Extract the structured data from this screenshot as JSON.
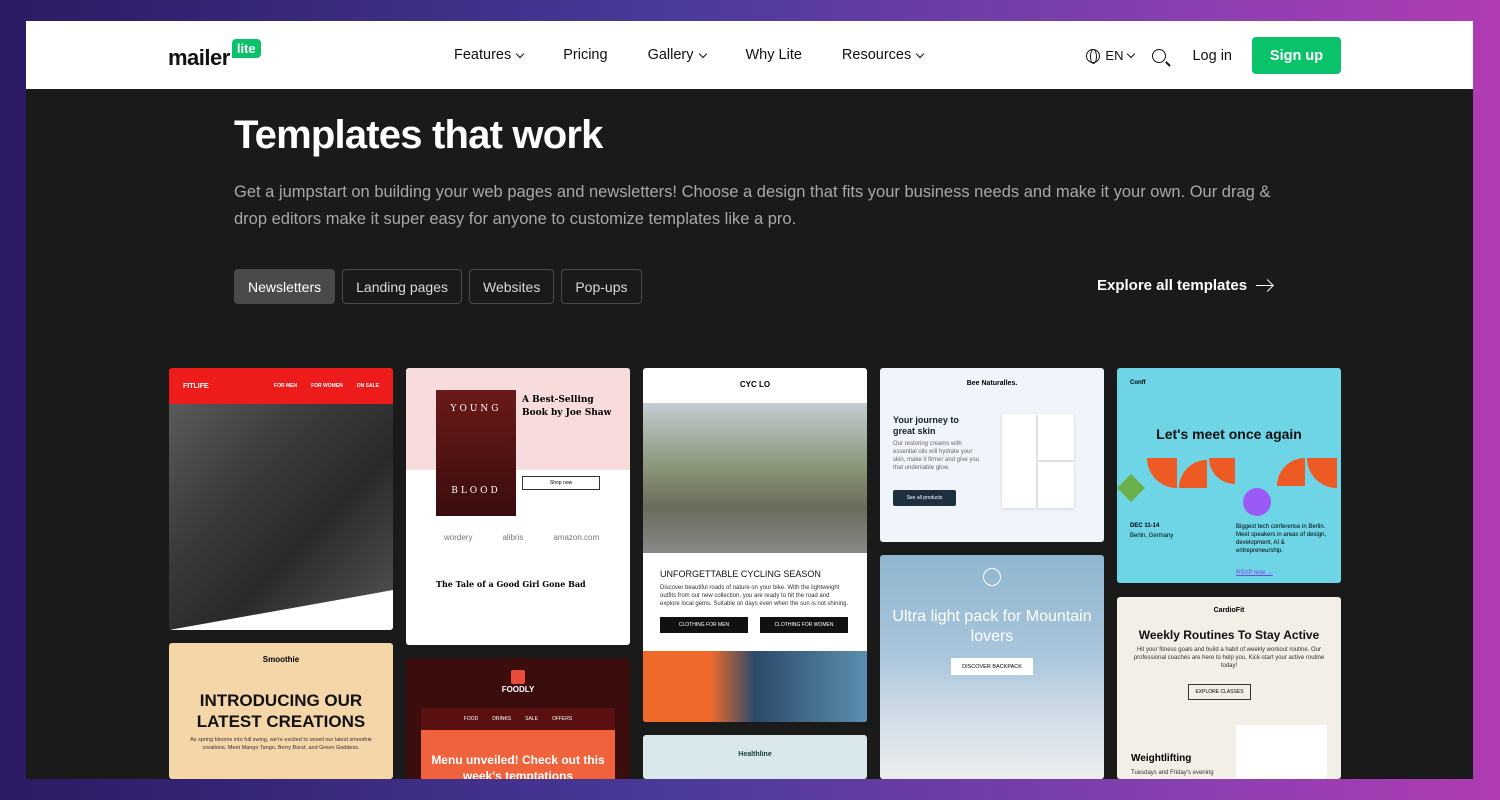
{
  "nav": {
    "logo_word": "mailer",
    "logo_badge": "lite",
    "items": [
      {
        "label": "Features",
        "dropdown": true
      },
      {
        "label": "Pricing",
        "dropdown": false
      },
      {
        "label": "Gallery",
        "dropdown": true
      },
      {
        "label": "Why Lite",
        "dropdown": false
      },
      {
        "label": "Resources",
        "dropdown": true
      }
    ],
    "language": "EN",
    "login": "Log in",
    "signup": "Sign up",
    "accent": "#09c269"
  },
  "hero": {
    "title": "Templates that work",
    "description": "Get a jumpstart on building your web pages and newsletters! Choose a design that fits your business needs and make it your own. Our drag & drop editors make it super easy for anyone to customize templates like a pro."
  },
  "tabs": [
    {
      "label": "Newsletters",
      "active": true
    },
    {
      "label": "Landing pages",
      "active": false
    },
    {
      "label": "Websites",
      "active": false
    },
    {
      "label": "Pop-ups",
      "active": false
    }
  ],
  "explore": "Explore all templates",
  "templates": {
    "fitlife": {
      "brand": "FITLIFE",
      "links": [
        "FOR MEN",
        "FOR WOMEN",
        "ON SALE"
      ]
    },
    "young_blood": {
      "book_top": "YOUNG",
      "book_bottom": "BLOOD",
      "title": "A Best-Selling Book by Joe Shaw",
      "button": "Shop now",
      "brands": [
        "wordery",
        "alibris",
        "amazon.com"
      ],
      "heading": "The Tale of a Good Girl Gone Bad"
    },
    "cyclo": {
      "brand": "CYC LO",
      "heading": "UNFORGETTABLE CYCLING SEASON",
      "text": "Discover beautiful roads of nature on your bike. With the lightweight outfits from our new collection, you are ready to hit the road and explore local gems. Suitable on days even when the sun is not shining.",
      "btn_men": "CLOTHING FOR MEN",
      "btn_women": "CLOTHING FOR WOMEN"
    },
    "bee": {
      "brand": "Bee Naturalles.",
      "heading": "Your journey to great skin",
      "text": "Our restoring creams with essential oils will hydrate your skin, make it firmer and give you that undeniable glow.",
      "button": "See all products"
    },
    "conff": {
      "brand": "Conff",
      "heading": "Let's meet once again",
      "date": "DEC 11-14",
      "place": "Berlin, Germany",
      "text": "Biggest tech conference in Berlin. Meet speakers in areas of design, development, AI & entrepreneurship.",
      "link": "RSVP now →"
    },
    "healthline": {
      "brand": "Healthline"
    },
    "ultra": {
      "heading": "Ultra light pack for Mountain lovers",
      "button": "DISCOVER BACKPACK"
    },
    "cardio": {
      "brand": "CardioFit",
      "heading": "Weekly Routines To Stay Active",
      "text": "Hit your fitness goals and build a habit of weekly workout routine. Our professional coaches are here to help you. Kick-start your active routine today!",
      "button": "EXPLORE CLASSES",
      "sub": "Weightlifting",
      "subtext": "Tuesdays and Friday's evening"
    },
    "smoothie": {
      "brand": "Smoothie",
      "heading": "INTRODUCING OUR LATEST CREATIONS",
      "text": "As spring blooms into full swing, we're excited to unveil our latest smoothie creations. Meet Mango Tango, Berry Burst, and Green Goddess."
    },
    "foodly": {
      "brand": "FOODLY",
      "links": [
        "FOOD",
        "DRINKS",
        "SALE",
        "OFFERS"
      ],
      "heading": "Menu unveiled! Check out this week's temptations"
    }
  }
}
